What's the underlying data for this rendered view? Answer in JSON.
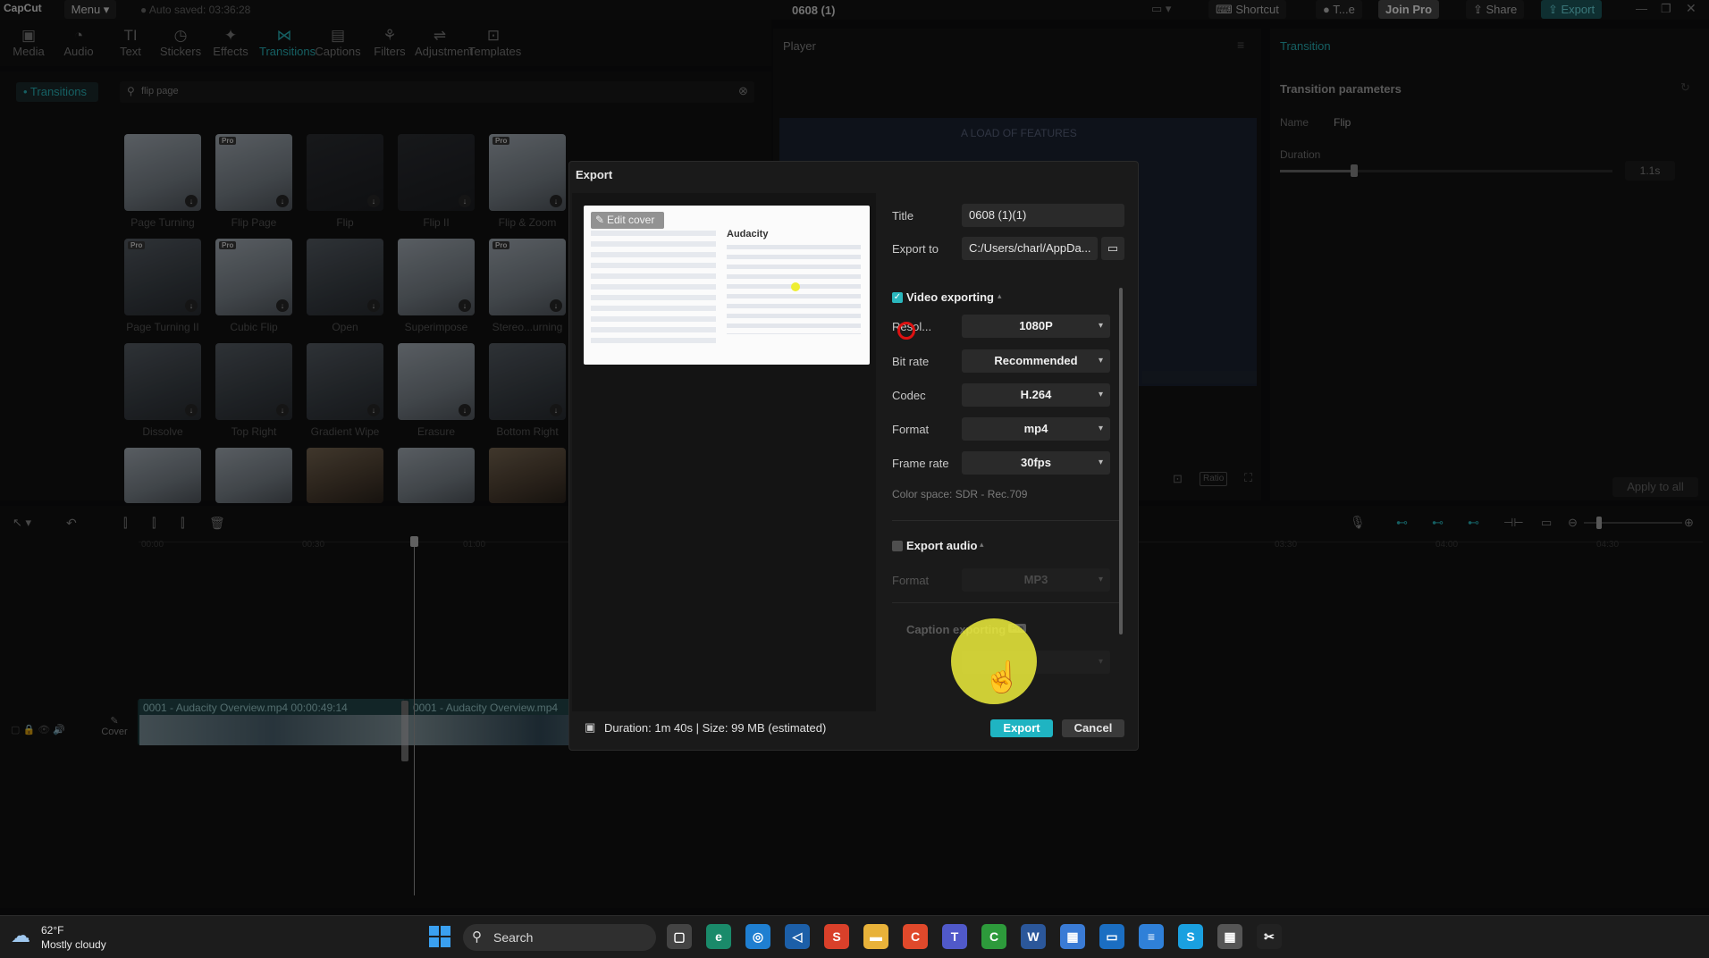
{
  "app": {
    "logo": "CapCut",
    "menu": "Menu",
    "autosave": "Auto saved: 03:36:28",
    "title": "0608 (1)",
    "top_buttons": {
      "shortcut": "Shortcut",
      "team": "T...e",
      "join_pro": "Join Pro",
      "share": "Share",
      "export": "Export"
    }
  },
  "toolbar": {
    "tools": [
      {
        "label": "Media",
        "icon": "media-icon",
        "glyph": "▣"
      },
      {
        "label": "Audio",
        "icon": "audio-icon",
        "glyph": "◔"
      },
      {
        "label": "Text",
        "icon": "text-icon",
        "glyph": "TI"
      },
      {
        "label": "Stickers",
        "icon": "stickers-icon",
        "glyph": "◷"
      },
      {
        "label": "Effects",
        "icon": "effects-icon",
        "glyph": "✦"
      },
      {
        "label": "Transitions",
        "icon": "transitions-icon",
        "glyph": "⋈"
      },
      {
        "label": "Captions",
        "icon": "captions-icon",
        "glyph": "▤"
      },
      {
        "label": "Filters",
        "icon": "filters-icon",
        "glyph": "⚘"
      },
      {
        "label": "Adjustment",
        "icon": "adjustment-icon",
        "glyph": "⇌"
      },
      {
        "label": "Templates",
        "icon": "templates-icon",
        "glyph": "⊡"
      }
    ]
  },
  "left_panel": {
    "category": "• Transitions",
    "search_value": "flip page",
    "thumbnails": [
      {
        "label": "Page Turning",
        "pro": false,
        "tone": "light"
      },
      {
        "label": "Flip Page",
        "pro": true,
        "tone": "light"
      },
      {
        "label": "Flip",
        "pro": false,
        "tone": "dark"
      },
      {
        "label": "Flip II",
        "pro": false,
        "tone": "dark"
      },
      {
        "label": "Flip & Zoom",
        "pro": true,
        "tone": "light"
      },
      {
        "label": "Page Turning II",
        "pro": true,
        "tone": "base"
      },
      {
        "label": "Cubic Flip",
        "pro": true,
        "tone": "light"
      },
      {
        "label": "Open",
        "pro": false,
        "tone": "base"
      },
      {
        "label": "Superimpose",
        "pro": false,
        "tone": "light"
      },
      {
        "label": "Stereo...urning",
        "pro": true,
        "tone": "light"
      },
      {
        "label": "Dissolve",
        "pro": false,
        "tone": "base"
      },
      {
        "label": "Top Right",
        "pro": false,
        "tone": "base"
      },
      {
        "label": "Gradient Wipe",
        "pro": false,
        "tone": "base"
      },
      {
        "label": "Erasure",
        "pro": false,
        "tone": "light"
      },
      {
        "label": "Bottom Right",
        "pro": false,
        "tone": "base"
      }
    ]
  },
  "player": {
    "title": "Player",
    "preview_heading": "A LOAD OF FEATURES",
    "ratio": "Ratio"
  },
  "right_panel": {
    "title": "Transition",
    "params_title": "Transition parameters",
    "name_label": "Name",
    "name_value": "Flip",
    "duration_label": "Duration",
    "duration_value": "1.1s",
    "duration_fraction": 0.2,
    "apply_all": "Apply to all"
  },
  "timeline": {
    "ticks": [
      "00:00",
      "00:30",
      "01:00",
      "03:30",
      "04:00",
      "04:30"
    ],
    "cover": "Cover",
    "clips": [
      {
        "label": "0001 - Audacity Overview.mp4  00:00:49:14"
      },
      {
        "label": "0001 - Audacity Overview.mp4"
      }
    ]
  },
  "export_dialog": {
    "title": "Export",
    "edit_cover": "Edit cover",
    "title_label": "Title",
    "title_value": "0608 (1)(1)",
    "export_to_label": "Export to",
    "export_to_value": "C:/Users/charl/AppDa...",
    "video_section": "Video exporting",
    "resolution_label": "Resol...",
    "resolution_value": "1080P",
    "bitrate_label": "Bit rate",
    "bitrate_value": "Recommended",
    "codec_label": "Codec",
    "codec_value": "H.264",
    "format_label": "Format",
    "format_value": "mp4",
    "framerate_label": "Frame rate",
    "framerate_value": "30fps",
    "color_space": "Color space: SDR - Rec.709",
    "audio_section": "Export audio",
    "audio_format_label": "Format",
    "audio_format_value": "MP3",
    "caption_section": "Caption exporting",
    "caption_badge": "Pro",
    "footer_info": "Duration: 1m 40s | Size: 99 MB (estimated)",
    "export_btn": "Export",
    "cancel_btn": "Cancel",
    "video_checked": true,
    "audio_checked": false
  },
  "taskbar": {
    "temp": "62°F",
    "weather": "Mostly cloudy",
    "search": "Search",
    "apps": [
      {
        "name": "task-view-icon",
        "glyph": "▢",
        "color": "#444"
      },
      {
        "name": "edge-icon",
        "glyph": "e",
        "color": "#1a8a6a"
      },
      {
        "name": "browser-icon",
        "glyph": "◎",
        "color": "#1f7fd1"
      },
      {
        "name": "vscode-icon",
        "glyph": "◁",
        "color": "#1c5fa8"
      },
      {
        "name": "s-app-icon",
        "glyph": "S",
        "color": "#d9402a"
      },
      {
        "name": "folder-icon",
        "glyph": "▬",
        "color": "#e8b23a"
      },
      {
        "name": "c-app-icon",
        "glyph": "C",
        "color": "#e0492b"
      },
      {
        "name": "teams-icon",
        "glyph": "T",
        "color": "#5059c9"
      },
      {
        "name": "camtasia-icon",
        "glyph": "C",
        "color": "#2d9a3b"
      },
      {
        "name": "word-icon",
        "glyph": "W",
        "color": "#2b579a"
      },
      {
        "name": "store-icon",
        "glyph": "▦",
        "color": "#3a7bd5"
      },
      {
        "name": "remote-icon",
        "glyph": "▭",
        "color": "#1b6ec2"
      },
      {
        "name": "notepad-icon",
        "glyph": "≡",
        "color": "#2f80d8"
      },
      {
        "name": "skype-icon",
        "glyph": "S",
        "color": "#1aa0e0"
      },
      {
        "name": "calculator-icon",
        "glyph": "▦",
        "color": "#555"
      },
      {
        "name": "capcut-icon",
        "glyph": "✂",
        "color": "#222"
      }
    ]
  }
}
